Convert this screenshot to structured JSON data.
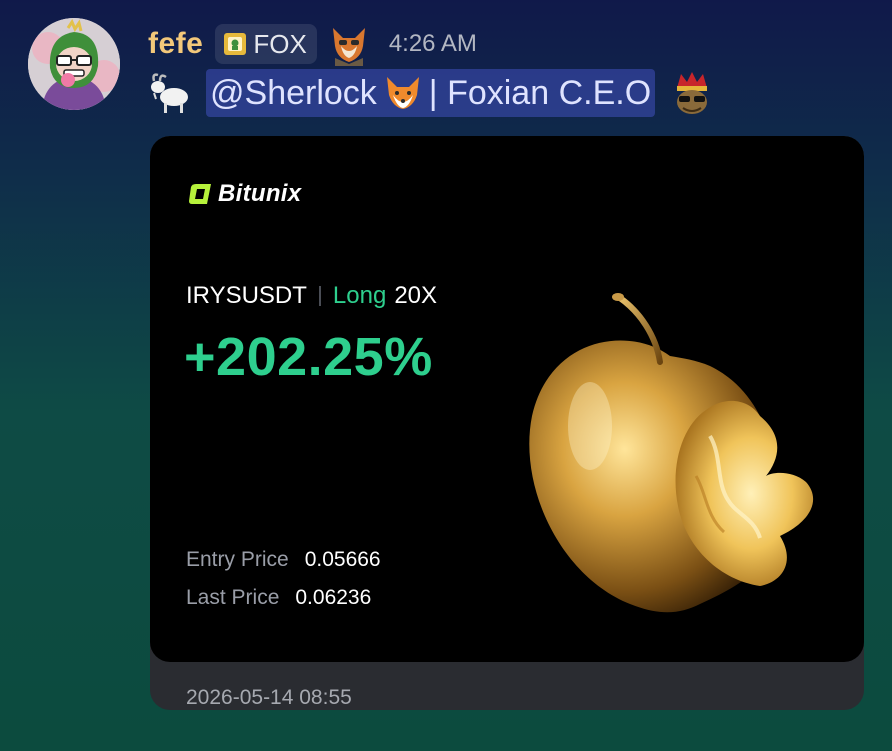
{
  "message": {
    "username": "fefe",
    "role_tag": "FOX",
    "timestamp": "4:26 AM",
    "mention": "@Sherlock",
    "mention_suffix": "| Foxian C.E.O",
    "icons": {
      "avatar": "green-dinosaur-hoodie-avatar",
      "role": "shield-icon",
      "badge": "fox-detective-emoji-icon",
      "prefix": "goat-emoji-icon",
      "mention_emoji": "fox-face-icon",
      "suffix": "crowned-king-emoji-icon"
    }
  },
  "card": {
    "brand": "Bitunix",
    "pair": "IRYSUSDT",
    "side": "Long",
    "leverage": "20X",
    "pnl": "+202.25%",
    "entry_label": "Entry Price",
    "entry_value": "0.05666",
    "last_label": "Last Price",
    "last_value": "0.06236",
    "date": "2026-05-14 08:55",
    "image": "golden-bitten-apple",
    "colors": {
      "profit_green": "#2ecf8e",
      "brand_green": "#b6f23b",
      "gold": "#d9a441"
    }
  }
}
